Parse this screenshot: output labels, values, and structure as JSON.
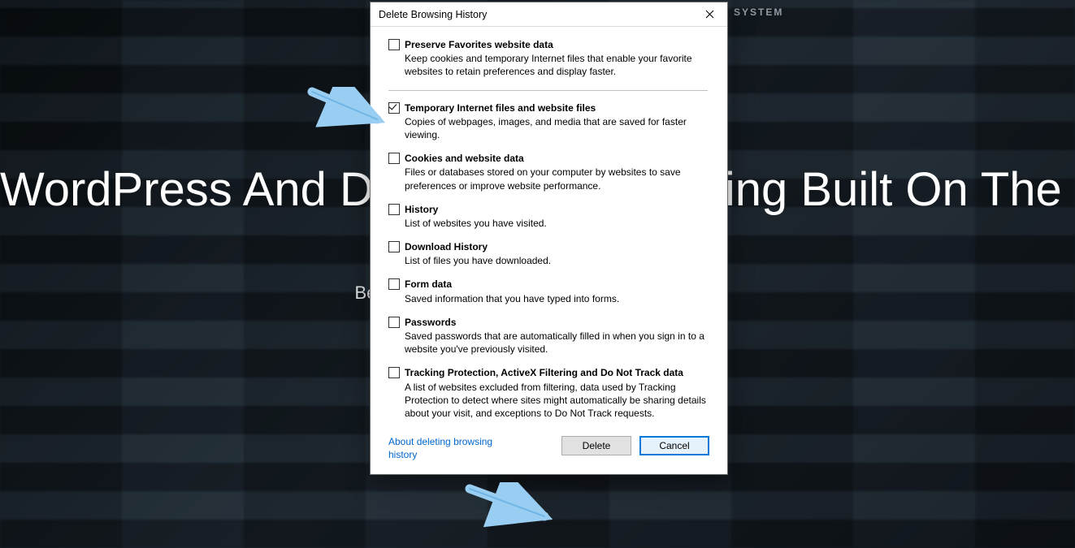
{
  "background": {
    "title": "WordPress And Drupal Cloud Hosting Built On The Speed Of Google",
    "subtitle": "Better, faster, stronger managed cloud hosting",
    "tag_fragment": "SYSTEM"
  },
  "dialog": {
    "title": "Delete Browsing History",
    "options": [
      {
        "title": "Preserve Favorites website data",
        "desc": "Keep cookies and temporary Internet files that enable your favorite websites to retain preferences and display faster.",
        "checked": false,
        "separator": true
      },
      {
        "title": "Temporary Internet files and website files",
        "desc": "Copies of webpages, images, and media that are saved for faster viewing.",
        "checked": true,
        "separator": false
      },
      {
        "title": "Cookies and website data",
        "desc": "Files or databases stored on your computer by websites to save preferences or improve website performance.",
        "checked": false,
        "separator": false
      },
      {
        "title": "History",
        "desc": "List of websites you have visited.",
        "checked": false,
        "separator": false
      },
      {
        "title": "Download History",
        "desc": "List of files you have downloaded.",
        "checked": false,
        "separator": false
      },
      {
        "title": "Form data",
        "desc": "Saved information that you have typed into forms.",
        "checked": false,
        "separator": false
      },
      {
        "title": "Passwords",
        "desc": "Saved passwords that are automatically filled in when you sign in to a website you've previously visited.",
        "checked": false,
        "separator": false
      },
      {
        "title": "Tracking Protection, ActiveX Filtering and Do Not Track data",
        "desc": "A list of websites excluded from filtering, data used by Tracking Protection to detect where sites might automatically be sharing details about your visit, and exceptions to Do Not Track requests.",
        "checked": false,
        "separator": false
      }
    ],
    "link": "About deleting browsing history",
    "buttons": {
      "delete": "Delete",
      "cancel": "Cancel"
    }
  }
}
